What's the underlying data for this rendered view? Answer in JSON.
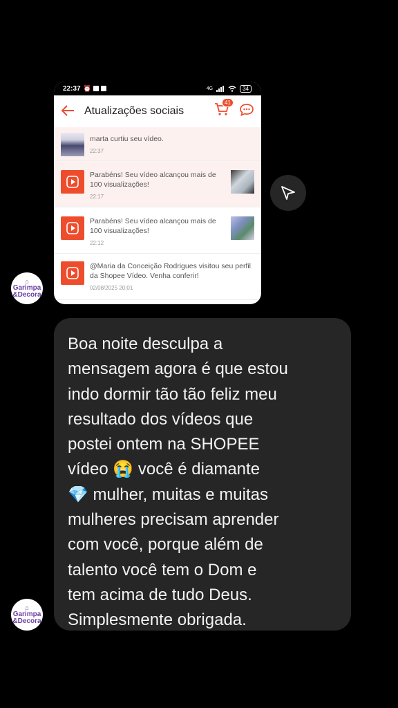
{
  "statusbar": {
    "time": "22:37",
    "network": "4G",
    "battery": "34"
  },
  "app": {
    "title": "Atualizações sociais",
    "back_icon": "arrow-left-icon",
    "cart_icon": "cart-icon",
    "cart_count": "41",
    "chat_icon": "chat-icon",
    "accent": "#ee4d2d"
  },
  "notifications": [
    {
      "text": "marta curtiu seu vídeo.",
      "time": "22:37"
    },
    {
      "text": "Parabéns! Seu vídeo alcançou mais de 100 visualizações!",
      "time": "22:17"
    },
    {
      "text": "Parabéns! Seu vídeo alcançou mais de 100 visualizações!",
      "time": "22:12"
    },
    {
      "text": "@Maria da Conceição Rodrigues visitou seu perfil da Shopee Vídeo. Venha conferir!",
      "time": "02/08/2025 20:01"
    }
  ],
  "avatar": {
    "line1": "Garimpa",
    "line2": "&Decora"
  },
  "message": {
    "text": "Boa noite desculpa a\nmensagem agora é que estou\nindo dormir tão tão feliz meu\nresultado dos vídeos que\npostei ontem na SHOPEE\nvídeo 😭 você é diamante\n💎 mulher, muitas e muitas\nmulheres precisam aprender\ncom você, porque além de\ntalento você tem o Dom e\ntem acima de tudo Deus.\nSimplesmente obrigada."
  },
  "share_icon": "send-icon"
}
